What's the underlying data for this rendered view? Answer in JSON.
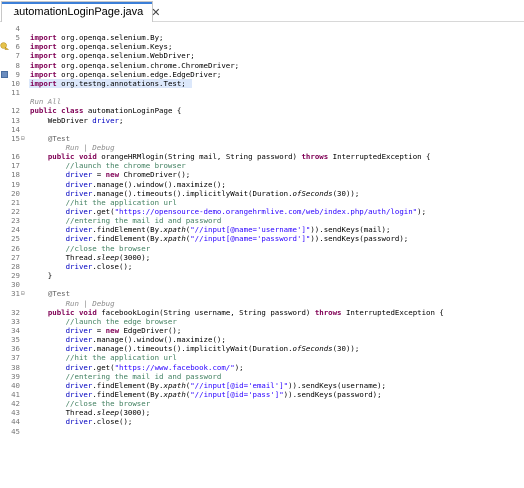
{
  "tab": {
    "title": "automationLoginPage.java",
    "close": "✕"
  },
  "lines": [
    {
      "n": "4",
      "t": [
        [
          "",
          ""
        ]
      ]
    },
    {
      "n": "5",
      "t": [
        [
          "kw",
          "import"
        ],
        [
          "",
          " org.openqa.selenium.By;"
        ]
      ]
    },
    {
      "n": "6",
      "t": [
        [
          "kw",
          "import"
        ],
        [
          "",
          " org.openqa.selenium.Keys;"
        ]
      ],
      "warn": true
    },
    {
      "n": "7",
      "t": [
        [
          "kw",
          "import"
        ],
        [
          "",
          " org.openqa.selenium.WebDriver;"
        ]
      ]
    },
    {
      "n": "8",
      "t": [
        [
          "kw",
          "import"
        ],
        [
          "",
          " org.openqa.selenium.chrome.ChromeDriver;"
        ]
      ]
    },
    {
      "n": "9",
      "t": [
        [
          "kw",
          "import"
        ],
        [
          "",
          " org.openqa.selenium.edge.EdgeDriver;"
        ]
      ],
      "mark": true
    },
    {
      "n": "10",
      "t": [
        [
          "kw",
          "import"
        ],
        [
          "",
          " org.testng.annotations.Test;"
        ]
      ],
      "hl": true
    },
    {
      "n": "11",
      "t": [
        [
          "",
          ""
        ]
      ]
    },
    {
      "lens": "Run All"
    },
    {
      "n": "12",
      "t": [
        [
          "kw",
          "public"
        ],
        [
          "",
          " "
        ],
        [
          "kw",
          "class"
        ],
        [
          "",
          " automationLoginPage {"
        ]
      ]
    },
    {
      "n": "13",
      "t": [
        [
          "",
          "    WebDriver "
        ],
        [
          "field",
          "driver"
        ],
        [
          "",
          ";"
        ]
      ]
    },
    {
      "n": "14",
      "t": [
        [
          "",
          ""
        ]
      ]
    },
    {
      "n": "15",
      "t": [
        [
          "",
          "    "
        ],
        [
          "ann",
          "@Test"
        ]
      ],
      "fold": true
    },
    {
      "lens": "        Run | Debug"
    },
    {
      "n": "16",
      "t": [
        [
          "",
          "    "
        ],
        [
          "kw",
          "public"
        ],
        [
          "",
          " "
        ],
        [
          "kw",
          "void"
        ],
        [
          "",
          " orangeHRMlogin(String mail, String password) "
        ],
        [
          "kw",
          "throws"
        ],
        [
          "",
          " InterruptedException {"
        ]
      ]
    },
    {
      "n": "17",
      "t": [
        [
          "cmt",
          "        //launch the chrome browser"
        ]
      ]
    },
    {
      "n": "18",
      "t": [
        [
          "",
          "        "
        ],
        [
          "field",
          "driver"
        ],
        [
          "",
          " = "
        ],
        [
          "kw",
          "new"
        ],
        [
          "",
          " ChromeDriver();"
        ]
      ]
    },
    {
      "n": "19",
      "t": [
        [
          "",
          "        "
        ],
        [
          "field",
          "driver"
        ],
        [
          "",
          ".manage().window().maximize();"
        ]
      ]
    },
    {
      "n": "20",
      "t": [
        [
          "",
          "        "
        ],
        [
          "field",
          "driver"
        ],
        [
          "",
          ".manage().timeouts().implicitlyWait(Duration."
        ],
        [
          "ital",
          "ofSeconds"
        ],
        [
          "",
          "(30));"
        ]
      ]
    },
    {
      "n": "21",
      "t": [
        [
          "cmt",
          "        //hit the application url"
        ]
      ]
    },
    {
      "n": "22",
      "t": [
        [
          "",
          "        "
        ],
        [
          "field",
          "driver"
        ],
        [
          "",
          ".get("
        ],
        [
          "str",
          "\"https://opensource-demo.orangehrmlive.com/web/index.php/auth/login\""
        ],
        [
          "",
          ");"
        ]
      ]
    },
    {
      "n": "23",
      "t": [
        [
          "cmt",
          "        //entering the mail id and password"
        ]
      ]
    },
    {
      "n": "24",
      "t": [
        [
          "",
          "        "
        ],
        [
          "field",
          "driver"
        ],
        [
          "",
          ".findElement(By."
        ],
        [
          "ital",
          "xpath"
        ],
        [
          "",
          "("
        ],
        [
          "str",
          "\"//input[@name='username']\""
        ],
        [
          "",
          ")).sendKeys(mail);"
        ]
      ]
    },
    {
      "n": "25",
      "t": [
        [
          "",
          "        "
        ],
        [
          "field",
          "driver"
        ],
        [
          "",
          ".findElement(By."
        ],
        [
          "ital",
          "xpath"
        ],
        [
          "",
          "("
        ],
        [
          "str",
          "\"//input[@name='password']\""
        ],
        [
          "",
          ")).sendKeys(password);"
        ]
      ]
    },
    {
      "n": "26",
      "t": [
        [
          "cmt",
          "        //close the browser"
        ]
      ]
    },
    {
      "n": "27",
      "t": [
        [
          "",
          "        Thread."
        ],
        [
          "ital",
          "sleep"
        ],
        [
          "",
          "(3000);"
        ]
      ]
    },
    {
      "n": "28",
      "t": [
        [
          "",
          "        "
        ],
        [
          "field",
          "driver"
        ],
        [
          "",
          ".close();"
        ]
      ]
    },
    {
      "n": "29",
      "t": [
        [
          "",
          "    }"
        ]
      ]
    },
    {
      "n": "30",
      "t": [
        [
          "",
          ""
        ]
      ]
    },
    {
      "n": "31",
      "t": [
        [
          "",
          "    "
        ],
        [
          "ann",
          "@Test"
        ]
      ],
      "fold": true
    },
    {
      "lens": "        Run | Debug"
    },
    {
      "n": "32",
      "t": [
        [
          "",
          "    "
        ],
        [
          "kw",
          "public"
        ],
        [
          "",
          " "
        ],
        [
          "kw",
          "void"
        ],
        [
          "",
          " facebookLogin(String username, String password) "
        ],
        [
          "kw",
          "throws"
        ],
        [
          "",
          " InterruptedException {"
        ]
      ]
    },
    {
      "n": "33",
      "t": [
        [
          "cmt",
          "        //launch the edge browser"
        ]
      ]
    },
    {
      "n": "34",
      "t": [
        [
          "",
          "        "
        ],
        [
          "field",
          "driver"
        ],
        [
          "",
          " = "
        ],
        [
          "kw",
          "new"
        ],
        [
          "",
          " EdgeDriver();"
        ]
      ]
    },
    {
      "n": "35",
      "t": [
        [
          "",
          "        "
        ],
        [
          "field",
          "driver"
        ],
        [
          "",
          ".manage().window().maximize();"
        ]
      ]
    },
    {
      "n": "36",
      "t": [
        [
          "",
          "        "
        ],
        [
          "field",
          "driver"
        ],
        [
          "",
          ".manage().timeouts().implicitlyWait(Duration."
        ],
        [
          "ital",
          "ofSeconds"
        ],
        [
          "",
          "(30));"
        ]
      ]
    },
    {
      "n": "37",
      "t": [
        [
          "cmt",
          "        //hit the application url"
        ]
      ]
    },
    {
      "n": "38",
      "t": [
        [
          "",
          "        "
        ],
        [
          "field",
          "driver"
        ],
        [
          "",
          ".get("
        ],
        [
          "str",
          "\"https://www.facebook.com/\""
        ],
        [
          "",
          ");"
        ]
      ]
    },
    {
      "n": "39",
      "t": [
        [
          "cmt",
          "        //entering the mail id and password"
        ]
      ]
    },
    {
      "n": "40",
      "t": [
        [
          "",
          "        "
        ],
        [
          "field",
          "driver"
        ],
        [
          "",
          ".findElement(By."
        ],
        [
          "ital",
          "xpath"
        ],
        [
          "",
          "("
        ],
        [
          "str",
          "\"//input[@id='email']\""
        ],
        [
          "",
          ")).sendKeys(username);"
        ]
      ]
    },
    {
      "n": "41",
      "t": [
        [
          "",
          "        "
        ],
        [
          "field",
          "driver"
        ],
        [
          "",
          ".findElement(By."
        ],
        [
          "ital",
          "xpath"
        ],
        [
          "",
          "("
        ],
        [
          "str",
          "\"//input[@id='pass']\""
        ],
        [
          "",
          ")).sendKeys(password);"
        ]
      ]
    },
    {
      "n": "42",
      "t": [
        [
          "cmt",
          "        //close the browser"
        ]
      ]
    },
    {
      "n": "43",
      "t": [
        [
          "",
          "        Thread."
        ],
        [
          "ital",
          "sleep"
        ],
        [
          "",
          "(3000);"
        ]
      ]
    },
    {
      "n": "44",
      "t": [
        [
          "",
          "        "
        ],
        [
          "field",
          "driver"
        ],
        [
          "",
          ".close();"
        ]
      ]
    },
    {
      "n": "45",
      "t": [
        [
          "",
          ""
        ]
      ]
    }
  ]
}
